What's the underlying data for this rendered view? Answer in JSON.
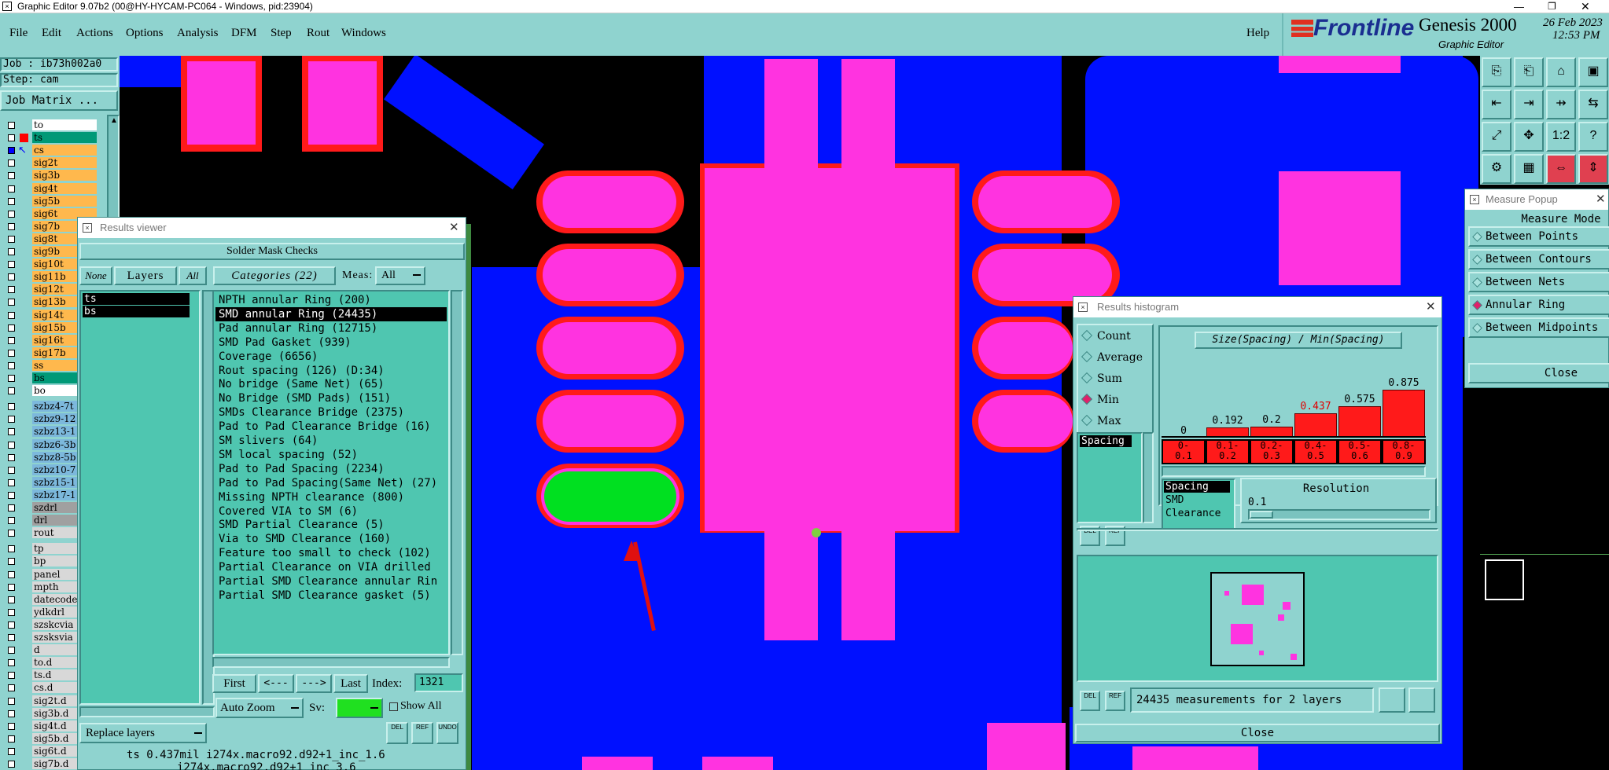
{
  "window_title": "Graphic Editor 9.07b2 (00@HY-HYCAM-PC064 - Windows, pid:23904)",
  "menu": [
    "File",
    "Edit",
    "Actions",
    "Options",
    "Analysis",
    "DFM",
    "Step",
    "Rout",
    "Windows"
  ],
  "help_label": "Help",
  "brand": {
    "logo": "Frontline",
    "product": "Genesis 2000",
    "subtitle": "Graphic Editor",
    "date": "26 Feb 2023",
    "time": "12:53 PM"
  },
  "job": {
    "job": "Job : ib73h002a0",
    "step": "Step: cam",
    "job_matrix": "Job Matrix ..."
  },
  "layers_group1": [
    "to",
    "ts",
    "cs",
    "sig2t",
    "sig3b",
    "sig4t",
    "sig5b",
    "sig6t",
    "sig7b",
    "sig8t",
    "sig9b",
    "sig10t",
    "sig11b",
    "sig12t",
    "sig13b",
    "sig14t",
    "sig15b",
    "sig16t",
    "sig17b",
    "ss",
    "bs",
    "bo"
  ],
  "layers_group2": [
    "szbz4-7t",
    "szbz9-12",
    "szbz13-1",
    "szbz6-3b",
    "szbz8-5b",
    "szbz10-7",
    "szbz15-1",
    "szbz17-1",
    "szdrl",
    "drl",
    "rout"
  ],
  "layers_group3": [
    "tp",
    "bp",
    "panel",
    "mpth",
    "datecode",
    "ydkdrl",
    "szskcvia",
    "szsksvia",
    "d",
    "to.d",
    "ts.d",
    "cs.d",
    "sig2t.d",
    "sig3b.d",
    "sig4t.d",
    "sig5b.d",
    "sig6t.d",
    "sig7b.d"
  ],
  "results_viewer": {
    "title": "Results viewer",
    "header": "Solder Mask Checks",
    "none_label": "None",
    "layers_label": "Layers",
    "all_label": "All",
    "categories_label": "Categories (22)",
    "meas_label": "Meas:",
    "meas_value": "All",
    "layer_list": [
      "ts",
      "bs"
    ],
    "categories": [
      "NPTH annular Ring (200)",
      "SMD annular Ring (24435)",
      "Pad annular Ring (12715)",
      "SMD Pad Gasket (939)",
      "Coverage (6656)",
      "Rout spacing (126)        (D:34)",
      "No bridge (Same Net) (65)",
      "No Bridge (SMD Pads) (151)",
      "SMDs Clearance Bridge (2375)",
      "Pad to Pad Clearance Bridge (16)",
      "SM slivers (64)",
      "SM local spacing (52)",
      "Pad to Pad Spacing (2234)",
      "Pad to Pad Spacing(Same Net) (27)",
      "Missing NPTH clearance (800)",
      "Covered VIA to SM (6)",
      "SMD Partial Clearance (5)",
      "Via to SMD Clearance (160)",
      "Feature too small to check (102)",
      "Partial Clearance on VIA drilled",
      "Partial SMD Clearance annular Rin",
      "Partial SMD Clearance gasket (5)"
    ],
    "first": "First",
    "prev": "<---",
    "next": "--->",
    "last": "Last",
    "index_label": "Index:",
    "index_value": "1321",
    "auto_zoom": "Auto Zoom",
    "sv_label": "Sv:",
    "show_all": "Show All",
    "replace_layers": "Replace layers",
    "status_line1": "ts 0.437mil  i274x.macro92.d92+1_inc_1.6",
    "status_line2": "i274x.macro92.d92+1_inc_3.6"
  },
  "histogram": {
    "title": "Results histogram",
    "modes": [
      "Count",
      "Average",
      "Sum",
      "Min",
      "Max"
    ],
    "selected_mode": "Min",
    "chart_title": "Size(Spacing) / Min(Spacing)",
    "list_item": "Spacing",
    "bar_values": [
      "0",
      "0.192",
      "0.2",
      "0.437",
      "0.575",
      "0.875"
    ],
    "bins": [
      "0-\n0.1",
      "0.1-\n0.2",
      "0.2-\n0.3",
      "0.4-\n0.5",
      "0.5-\n0.6",
      "0.8-\n0.9"
    ],
    "types": [
      "Spacing",
      "SMD",
      "Clearance"
    ],
    "resolution_label": "Resolution",
    "resolution_value": "0.1",
    "summary": "24435 measurements for 2 layers",
    "close": "Close",
    "del": "DEL",
    "ref": "REF"
  },
  "measure": {
    "title": "Measure Popup",
    "mode_header": "Measure Mode",
    "modes": [
      "Between Points",
      "Between Contours",
      "Between Nets",
      "Annular Ring",
      "Between Midpoints"
    ],
    "selected": "Annular Ring",
    "close": "Close"
  },
  "toolbar_icons": [
    "copy-icon",
    "paste-icon",
    "home-icon",
    "window-icon",
    "undo-icon",
    "redo-icon",
    "step-icon",
    "split-icon",
    "fit-icon",
    "center-icon",
    "ratio-icon",
    "help-icon",
    "settings-icon",
    "grid-icon",
    "measure-icon",
    "layers-icon"
  ],
  "colors": {
    "panel": "#8fd3cf",
    "list": "#4fc6b0",
    "pad": "#ff33e0",
    "trace": "#0010ff",
    "highlight": "#00e020",
    "mask": "#ff1a1a"
  },
  "chart_data": {
    "type": "bar",
    "title": "Size(Spacing) / Min(Spacing)",
    "categories": [
      "0-0.1",
      "0.1-0.2",
      "0.2-0.3",
      "0.4-0.5",
      "0.5-0.6",
      "0.8-0.9"
    ],
    "values": [
      0,
      0.192,
      0.2,
      0.437,
      0.575,
      0.875
    ],
    "xlabel": "",
    "ylabel": ""
  }
}
